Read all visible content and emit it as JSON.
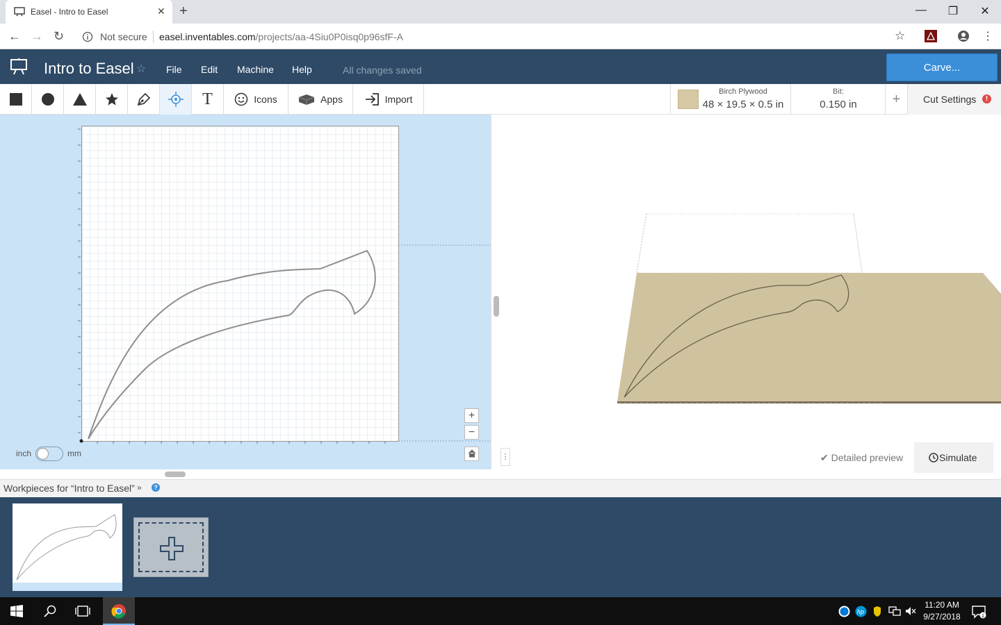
{
  "browser": {
    "tab_title": "Easel - Intro to Easel",
    "security_label": "Not secure",
    "url_host": "easel.inventables.com",
    "url_path": "/projects/aa-4Siu0P0isq0p96sfF-A"
  },
  "app": {
    "title": "Intro to Easel",
    "menu": [
      "File",
      "Edit",
      "Machine",
      "Help"
    ],
    "save_status": "All changes saved",
    "carve_label": "Carve..."
  },
  "toolbar": {
    "tools": [
      {
        "name": "square-tool",
        "icon": "square-icon"
      },
      {
        "name": "circle-tool",
        "icon": "circle-icon"
      },
      {
        "name": "triangle-tool",
        "icon": "triangle-icon"
      },
      {
        "name": "star-tool",
        "icon": "star-icon"
      },
      {
        "name": "pen-tool",
        "icon": "pen-icon"
      },
      {
        "name": "point-tool",
        "icon": "crosshair-icon"
      },
      {
        "name": "text-tool",
        "icon": "text-icon"
      }
    ],
    "icons_label": "Icons",
    "apps_label": "Apps",
    "import_label": "Import",
    "material_name": "Birch Plywood",
    "material_dims": "48 × 19.5 × 0.5 in",
    "material_color": "#d7c8a4",
    "bit_label": "Bit:",
    "bit_value": "0.150 in",
    "cut_settings_label": "Cut Settings",
    "cut_settings_alert": "!"
  },
  "canvas": {
    "unit_left": "inch",
    "unit_right": "mm",
    "unit_selected": "inch",
    "zoom_in": "+",
    "zoom_out": "−"
  },
  "preview": {
    "detailed_label": "Detailed preview",
    "simulate_label": "Simulate"
  },
  "workpieces": {
    "title": "Workpieces for “Intro to Easel”"
  },
  "taskbar": {
    "time": "11:20 AM",
    "date": "9/27/2018"
  },
  "colors": {
    "header": "#2e4a66",
    "accent": "#3b8fd9",
    "canvas_bg": "#cbe3f7",
    "wood": "#cfc29f"
  }
}
